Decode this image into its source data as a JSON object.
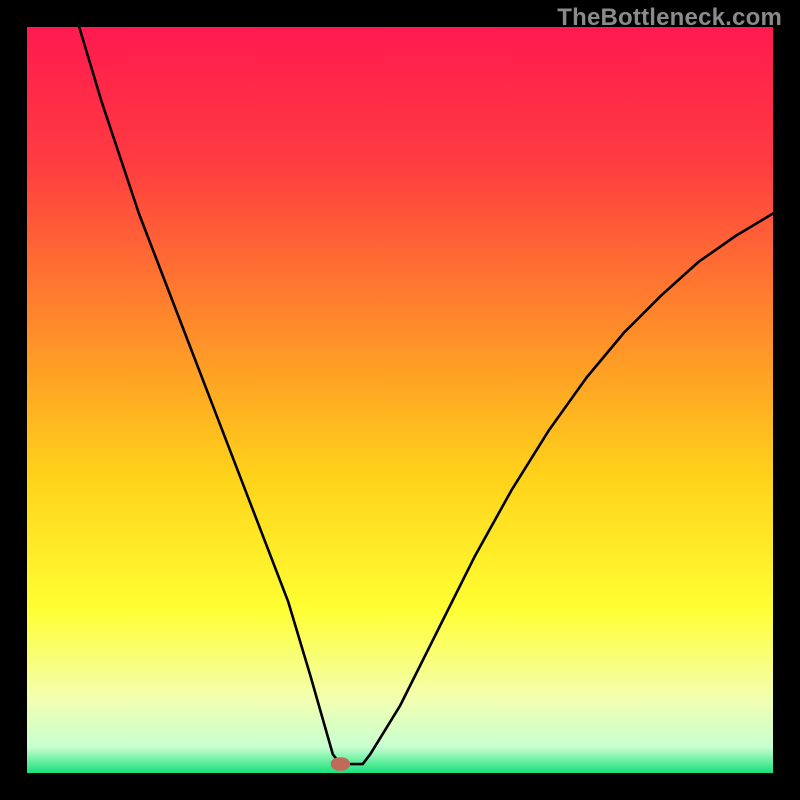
{
  "watermark": "TheBottleneck.com",
  "chart_data": {
    "type": "line",
    "title": "",
    "xlabel": "",
    "ylabel": "",
    "xlim": [
      0,
      100
    ],
    "ylim": [
      0,
      100
    ],
    "background_gradient": {
      "stops": [
        {
          "offset": 0,
          "color": "#ff1a4f"
        },
        {
          "offset": 0.18,
          "color": "#ff3b41"
        },
        {
          "offset": 0.4,
          "color": "#ff8a2a"
        },
        {
          "offset": 0.6,
          "color": "#ffd21a"
        },
        {
          "offset": 0.78,
          "color": "#ffff33"
        },
        {
          "offset": 0.9,
          "color": "#f3ffb0"
        },
        {
          "offset": 0.965,
          "color": "#c8ffd0"
        },
        {
          "offset": 1.0,
          "color": "#18e07a"
        }
      ]
    },
    "marker": {
      "x": 42,
      "y": 1.2,
      "color": "#c06a5a"
    },
    "series": [
      {
        "name": "curve",
        "x": [
          7.0,
          10,
          15,
          20,
          25,
          30,
          35,
          38,
          40,
          41,
          42,
          45,
          46,
          50,
          55,
          60,
          65,
          70,
          75,
          80,
          85,
          90,
          95,
          100
        ],
        "values": [
          100,
          90,
          75,
          62,
          49,
          36,
          23,
          13,
          6,
          2.5,
          1.2,
          1.2,
          2.5,
          9,
          19,
          29,
          38,
          46,
          53,
          59,
          64,
          68.5,
          72,
          75
        ]
      }
    ]
  }
}
